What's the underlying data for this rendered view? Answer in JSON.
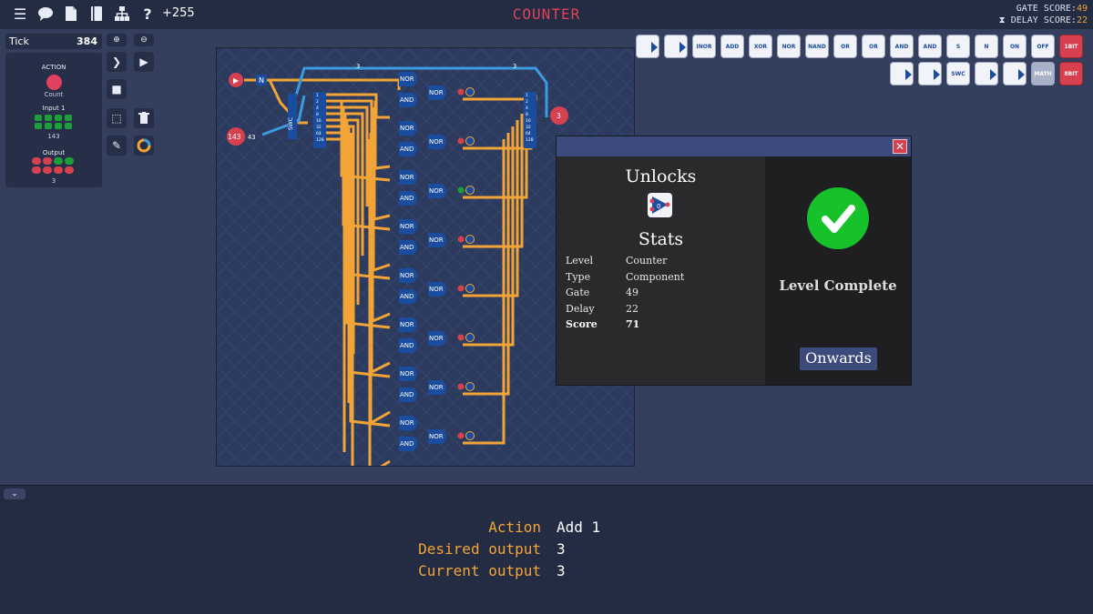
{
  "topbar": {
    "icons": [
      "menu-icon",
      "chat-icon",
      "document-icon",
      "book-icon",
      "hierarchy-icon",
      "help-icon"
    ],
    "counter": "+255",
    "title": "COUNTER",
    "gate_score_label": "GATE SCORE:",
    "gate_score_value": "49",
    "delay_score_label": "DELAY SCORE:",
    "delay_score_value": "22"
  },
  "tick": {
    "label": "Tick",
    "value": "384"
  },
  "io_panel": {
    "action_label": "ACTION",
    "action_name": "Count",
    "input_label": "Input 1",
    "input_value": "143",
    "output_label": "Output",
    "output_value": "3"
  },
  "canvas": {
    "bus_labels": [
      "3",
      "3"
    ],
    "input_value": "143",
    "input_wire_label": "43",
    "output_value": "3",
    "gate_labels": [
      "NOR",
      "AND"
    ],
    "splitter_bits": [
      "1",
      "2",
      "4",
      "8",
      "16",
      "32",
      "64",
      "128"
    ],
    "switch_label": "SWC",
    "not_label": "N"
  },
  "palette": {
    "row1": [
      "",
      "",
      "INOR",
      "ADD",
      "XOR",
      "NOR",
      "NAND",
      "OR",
      "OR",
      "AND",
      "AND",
      "S",
      "N",
      "ON",
      "OFF",
      "1BIT"
    ],
    "row2": [
      "",
      "",
      "SWC",
      "",
      "",
      "MATH",
      "8BIT"
    ]
  },
  "modal": {
    "unlocks_title": "Unlocks",
    "unlock_item": "0",
    "stats_title": "Stats",
    "stats": [
      {
        "label": "Level",
        "value": "Counter"
      },
      {
        "label": "Type",
        "value": "Component"
      },
      {
        "label": "Gate",
        "value": "49"
      },
      {
        "label": "Delay",
        "value": "22"
      },
      {
        "label": "Score",
        "value": "71"
      }
    ],
    "complete_text": "Level Complete",
    "onwards_label": "Onwards"
  },
  "bottom": {
    "action_label": "Action",
    "action_value": "Add 1",
    "desired_label": "Desired output",
    "desired_value": "3",
    "current_label": "Current output",
    "current_value": "3"
  },
  "colors": {
    "accent_red": "#d6404f",
    "title_red": "#e0415c",
    "wire_orange": "#f2a536",
    "wire_blue": "#3b9be0",
    "success_green": "#17c12a",
    "modal_bar": "#3d4a7c"
  }
}
